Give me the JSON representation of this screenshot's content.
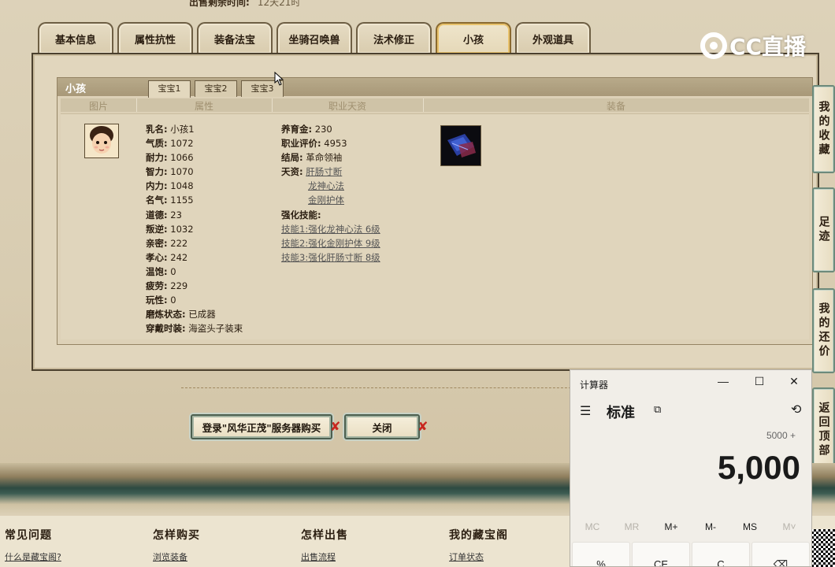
{
  "top_clip": {
    "label": "出售剩余时间:",
    "value": "12天21时"
  },
  "tabs": [
    {
      "label": "基本信息"
    },
    {
      "label": "属性抗性"
    },
    {
      "label": "装备法宝"
    },
    {
      "label": "坐骑召唤兽"
    },
    {
      "label": "法术修正"
    },
    {
      "label": "小孩",
      "active": true
    },
    {
      "label": "外观道具"
    }
  ],
  "panel": {
    "title": "小孩",
    "subtabs": [
      "宝宝1",
      "宝宝2",
      "宝宝3"
    ],
    "columns": [
      "图片",
      "属性",
      "职业天资",
      "装备"
    ],
    "attributes": [
      {
        "k": "乳名:",
        "v": "小孩1"
      },
      {
        "k": "气质:",
        "v": "1072"
      },
      {
        "k": "耐力:",
        "v": "1066"
      },
      {
        "k": "智力:",
        "v": "1070"
      },
      {
        "k": "内力:",
        "v": "1048"
      },
      {
        "k": "名气:",
        "v": "1155"
      },
      {
        "k": "道德:",
        "v": "23"
      },
      {
        "k": "叛逆:",
        "v": "1032"
      },
      {
        "k": "亲密:",
        "v": "222"
      },
      {
        "k": "孝心:",
        "v": "242"
      },
      {
        "k": "温饱:",
        "v": "0"
      },
      {
        "k": "疲劳:",
        "v": "229"
      },
      {
        "k": "玩性:",
        "v": "0"
      },
      {
        "k": "磨炼状态:",
        "v": "已成器"
      },
      {
        "k": "穿戴时装:",
        "v": "海盗头子装束"
      }
    ],
    "career": {
      "rows": [
        {
          "k": "养育金:",
          "v": "230"
        },
        {
          "k": "职业评价:",
          "v": "4953"
        },
        {
          "k": "结局:",
          "v": "革命领袖"
        }
      ],
      "talent_label": "天资:",
      "talents": [
        "肝肠寸断",
        "龙神心法",
        "金刚护体"
      ],
      "skills_label": "强化技能:",
      "skills": [
        "技能1:强化龙神心法 6级",
        "技能2:强化金刚护体 9级",
        "技能3:强化肝肠寸断 8级"
      ]
    }
  },
  "buttons": {
    "login_buy": "登录\"风华正茂\"服务器购买",
    "close": "关闭"
  },
  "logo": {
    "text": "CC直播"
  },
  "side_buttons": [
    "我的收藏",
    "足迹",
    "我的还价",
    "返回顶部"
  ],
  "footer": [
    {
      "heading": "常见问题",
      "link": "什么是藏宝阁?"
    },
    {
      "heading": "怎样购买",
      "link": "浏览装备"
    },
    {
      "heading": "怎样出售",
      "link": "出售流程"
    },
    {
      "heading": "我的藏宝阁",
      "link": "订单状态"
    }
  ],
  "calculator": {
    "title": "计算器",
    "mode": "标准",
    "expression": "5000 +",
    "display": "5,000",
    "memory": [
      "MC",
      "MR",
      "M+",
      "M-",
      "MS",
      "M˅"
    ],
    "keys": [
      "%",
      "CE",
      "C",
      "⌫"
    ]
  },
  "colors": {
    "tab_active_border": "#8a6a30",
    "band_dark": "#2e4a42",
    "close_x": "#c8261e"
  }
}
